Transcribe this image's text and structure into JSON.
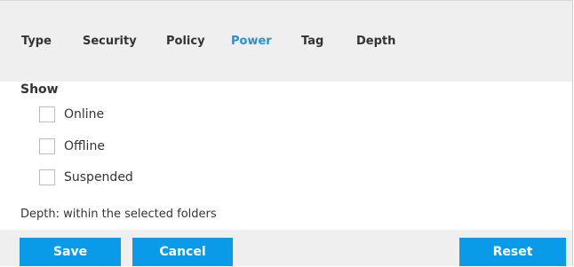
{
  "tabs": [
    {
      "label": "Type"
    },
    {
      "label": "Security"
    },
    {
      "label": "Policy"
    },
    {
      "label": "Power"
    },
    {
      "label": "Tag"
    },
    {
      "label": "Depth"
    }
  ],
  "active_tab": "Power",
  "show": {
    "heading": "Show",
    "options": [
      {
        "label": "Online",
        "checked": false
      },
      {
        "label": "Offline",
        "checked": false
      },
      {
        "label": "Suspended",
        "checked": false
      }
    ]
  },
  "depth_text": "Depth: within the selected folders",
  "buttons": {
    "save": "Save",
    "cancel": "Cancel",
    "reset": "Reset"
  },
  "colors": {
    "accent": "#2b8fd3",
    "button_bg": "#0a9be8",
    "bar_bg": "#efefef"
  }
}
